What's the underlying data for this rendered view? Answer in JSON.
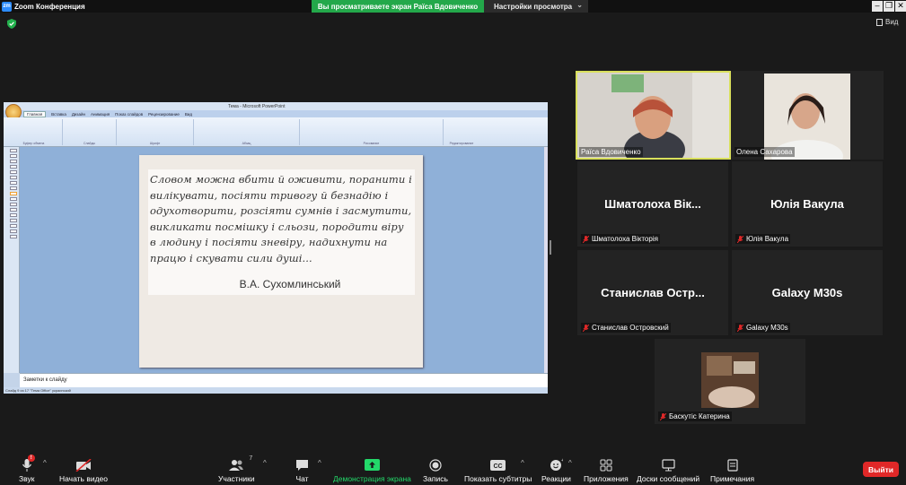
{
  "title_bar": {
    "app_title": "Zoom Конференция",
    "sharing_notice": "Вы просматриваете экран Раїса Вдовиченко",
    "view_options": "Настройки просмотра"
  },
  "view_toggle": {
    "label": "Вид"
  },
  "shared_screen": {
    "window_title": "Тема - Microsoft PowerPoint",
    "tabs": [
      "Главная",
      "Вставка",
      "Дизайн",
      "Анимация",
      "Показ слайдов",
      "Рецензирование",
      "Вид"
    ],
    "ribbon_groups": [
      "Буфер обмена",
      "Слайды",
      "Шрифт",
      "Абзац",
      "Рисование",
      "Редактирование"
    ],
    "slide_quote": "Словом можна вбити й оживити, поранити і вилікувати, посіяти тривогу й безнадію і одухотворити, розсіяти сумнів і засмутити, викликати посмішку і сльози, породити віру в людину і посіяти зневіру, надихнути на працю і скувати сили душі...",
    "slide_author": "В.А. Сухомлинський",
    "notes_placeholder": "Заметки к слайду",
    "status_text": "Слайд 9 из 17   \"Тема Office\"   украинский"
  },
  "participants": [
    {
      "name": "Раїса Вдовиченко",
      "video": true,
      "active": true
    },
    {
      "name": "Олена Сахарова",
      "video": true
    },
    {
      "name": "Шматолоха Вікторія",
      "display": "Шматолоха  Вік...",
      "muted": true
    },
    {
      "name": "Юлія Вакула",
      "display": "Юлія Вакула",
      "muted": true
    },
    {
      "name": "Станислав Островский",
      "display": "Станислав  Остр...",
      "muted": true
    },
    {
      "name": "Galaxy M30s",
      "display": "Galaxy M30s",
      "muted": true
    },
    {
      "name": "Баскутіс Катерина",
      "video": true,
      "muted": true
    }
  ],
  "toolbar": {
    "audio": "Звук",
    "audio_badge": "!",
    "video": "Начать видео",
    "participants": "Участники",
    "participants_count": "7",
    "chat": "Чат",
    "share": "Демонстрация экрана",
    "record": "Запись",
    "captions": "Показать субтитры",
    "reactions": "Реакции",
    "apps": "Приложения",
    "whiteboards": "Доски сообщений",
    "notes": "Примечания",
    "leave": "Выйти"
  },
  "colors": {
    "share_green": "#23a84a",
    "leave_red": "#e02828",
    "active_outline": "#d9e05c"
  }
}
